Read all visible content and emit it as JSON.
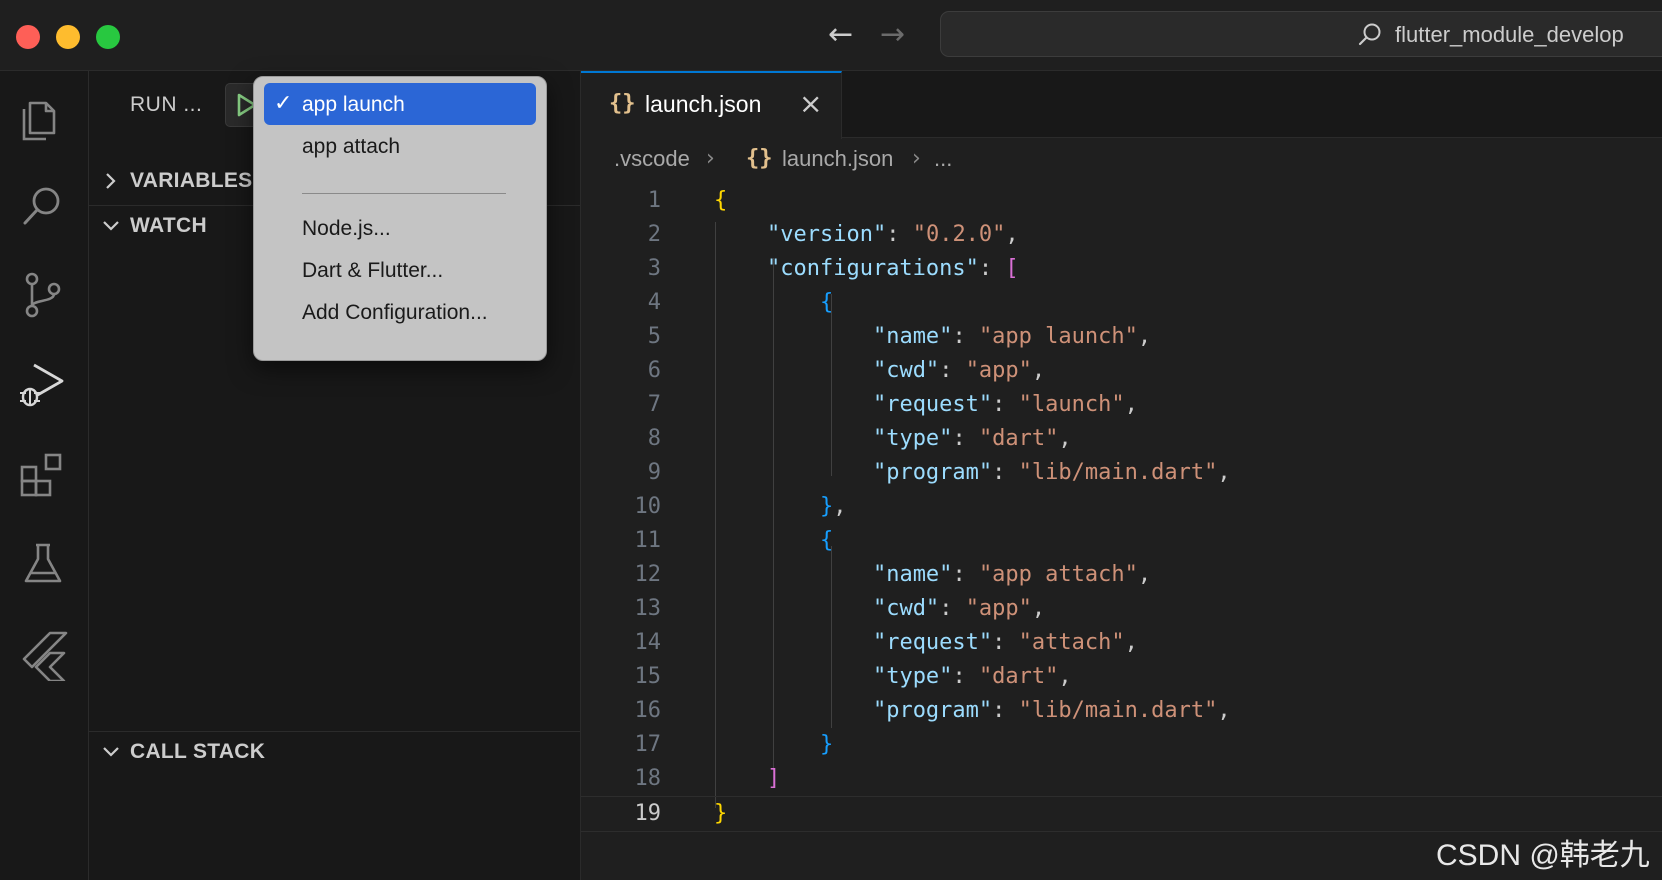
{
  "window": {
    "search_text": "flutter_module_develop"
  },
  "sidebar": {
    "run_title": "RUN ...",
    "sections": {
      "variables": "VARIABLES",
      "watch": "WATCH",
      "call_stack": "CALL STACK"
    }
  },
  "dropdown": {
    "items": [
      {
        "label": "app launch",
        "selected": true
      },
      {
        "label": "app attach",
        "selected": false
      },
      {
        "label": "Node.js...",
        "selected": false
      },
      {
        "label": "Dart & Flutter...",
        "selected": false
      },
      {
        "label": "Add Configuration...",
        "selected": false
      }
    ],
    "separator": "———————————"
  },
  "editor": {
    "tab": {
      "braces": "{}",
      "filename": "launch.json",
      "close": "×"
    },
    "breadcrumb": {
      "folder": ".vscode",
      "braces": "{}",
      "file": "launch.json",
      "more": "..."
    },
    "active_line": 19,
    "lines": [
      {
        "n": "1",
        "text": "{"
      },
      {
        "n": "2",
        "text": "    \"version\": \"0.2.0\","
      },
      {
        "n": "3",
        "text": "    \"configurations\": ["
      },
      {
        "n": "4",
        "text": "        {"
      },
      {
        "n": "5",
        "text": "            \"name\": \"app launch\","
      },
      {
        "n": "6",
        "text": "            \"cwd\": \"app\","
      },
      {
        "n": "7",
        "text": "            \"request\": \"launch\","
      },
      {
        "n": "8",
        "text": "            \"type\": \"dart\","
      },
      {
        "n": "9",
        "text": "            \"program\": \"lib/main.dart\","
      },
      {
        "n": "10",
        "text": "        },"
      },
      {
        "n": "11",
        "text": "        {"
      },
      {
        "n": "12",
        "text": "            \"name\": \"app attach\","
      },
      {
        "n": "13",
        "text": "            \"cwd\": \"app\","
      },
      {
        "n": "14",
        "text": "            \"request\": \"attach\","
      },
      {
        "n": "15",
        "text": "            \"type\": \"dart\","
      },
      {
        "n": "16",
        "text": "            \"program\": \"lib/main.dart\","
      },
      {
        "n": "17",
        "text": "        }"
      },
      {
        "n": "18",
        "text": "    ]"
      },
      {
        "n": "19",
        "text": "}"
      }
    ]
  },
  "watermark": "CSDN @韩老九",
  "colors": {
    "accent": "#0078d4",
    "selection": "#2b66d6",
    "json_key": "#9cdcfe",
    "json_string": "#ce9178",
    "bracket_gold": "#ffd700",
    "bracket_purple": "#da70d6",
    "bracket_blue": "#179fff"
  },
  "icons": {
    "activity_bar": [
      "explorer-icon",
      "search-icon",
      "source-control-icon",
      "run-debug-icon",
      "extensions-icon",
      "testing-icon",
      "flutter-icon"
    ]
  }
}
